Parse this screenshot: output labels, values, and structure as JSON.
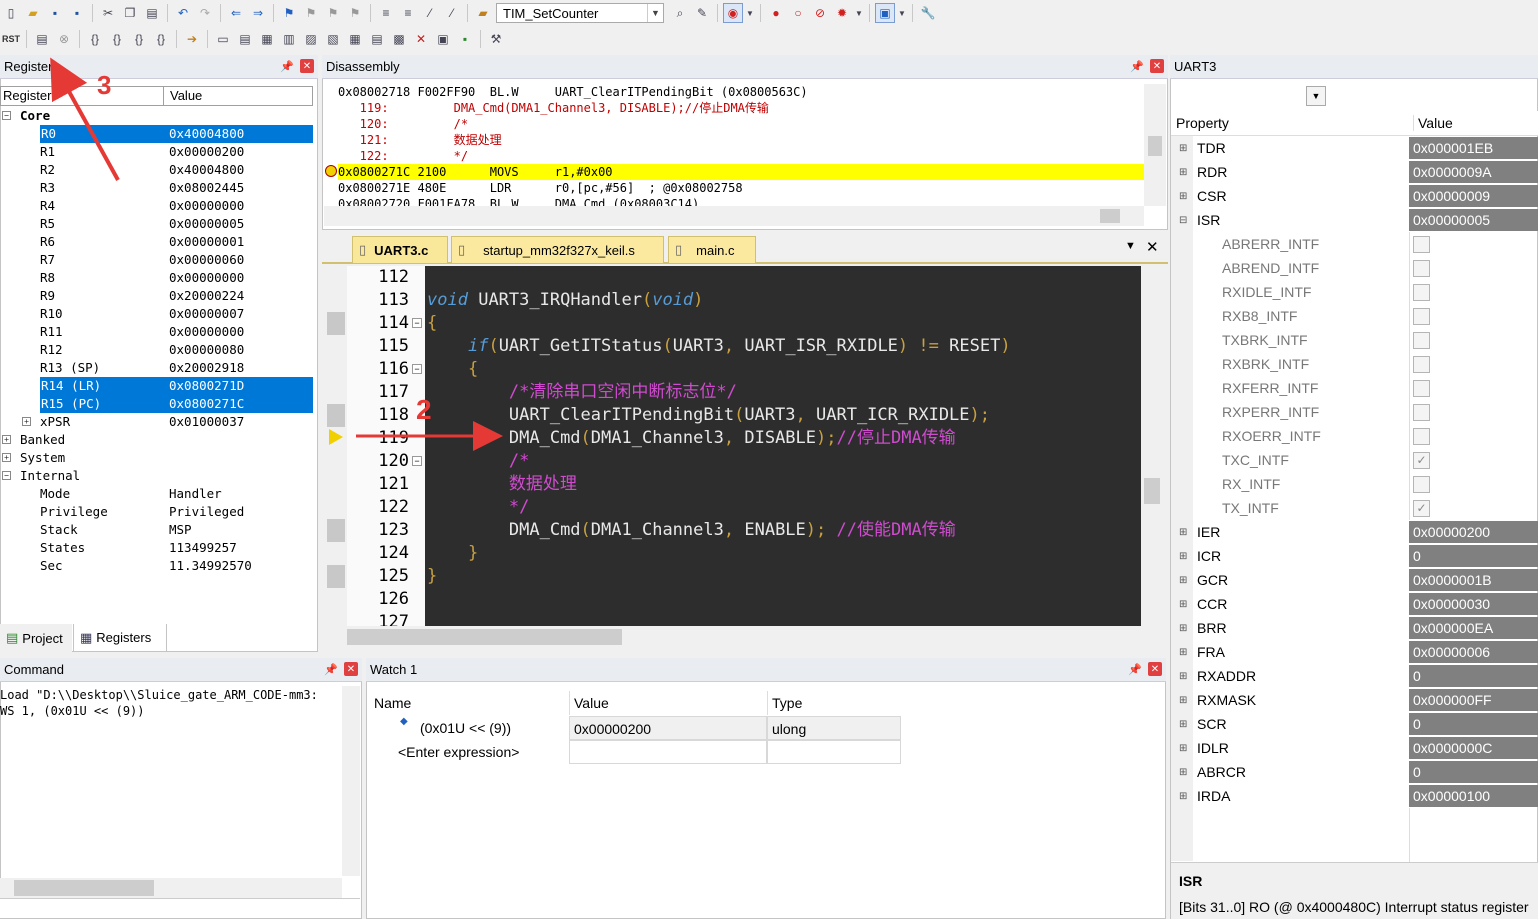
{
  "toolbar": {
    "target_combo": "TIM_SetCounter"
  },
  "registers": {
    "title": "Registers",
    "col_register": "Register",
    "col_value": "Value",
    "rows": [
      {
        "name": "Core",
        "value": ""
      },
      {
        "name": "R0",
        "value": "0x40004800"
      },
      {
        "name": "R1",
        "value": "0x00000200"
      },
      {
        "name": "R2",
        "value": "0x40004800"
      },
      {
        "name": "R3",
        "value": "0x08002445"
      },
      {
        "name": "R4",
        "value": "0x00000000"
      },
      {
        "name": "R5",
        "value": "0x00000005"
      },
      {
        "name": "R6",
        "value": "0x00000001"
      },
      {
        "name": "R7",
        "value": "0x00000060"
      },
      {
        "name": "R8",
        "value": "0x00000000"
      },
      {
        "name": "R9",
        "value": "0x20000224"
      },
      {
        "name": "R10",
        "value": "0x00000007"
      },
      {
        "name": "R11",
        "value": "0x00000000"
      },
      {
        "name": "R12",
        "value": "0x00000080"
      },
      {
        "name": "R13 (SP)",
        "value": "0x20002918"
      },
      {
        "name": "R14 (LR)",
        "value": "0x0800271D"
      },
      {
        "name": "R15 (PC)",
        "value": "0x0800271C"
      },
      {
        "name": "xPSR",
        "value": "0x01000037"
      },
      {
        "name": "Banked",
        "value": ""
      },
      {
        "name": "System",
        "value": ""
      },
      {
        "name": "Internal",
        "value": ""
      },
      {
        "name": "Mode",
        "value": "Handler"
      },
      {
        "name": "Privilege",
        "value": "Privileged"
      },
      {
        "name": "Stack",
        "value": "MSP"
      },
      {
        "name": "States",
        "value": "113499257"
      },
      {
        "name": "Sec",
        "value": "11.34992570"
      }
    ],
    "tab_project": "Project",
    "tab_registers": "Registers"
  },
  "disassembly": {
    "title": "Disassembly",
    "lines": [
      "0x08002718 F002FF90  BL.W     UART_ClearITPendingBit (0x0800563C)",
      "   119:         DMA_Cmd(DMA1_Channel3, DISABLE);//停止DMA传输",
      "   120:         /*",
      "   121:         数据处理",
      "   122:         */",
      "0x0800271C 2100      MOVS     r1,#0x00",
      "0x0800271E 480E      LDR      r0,[pc,#56]  ; @0x08002758",
      "0x08002720 F001FA78  BL.W     DMA_Cmd (0x08003C14)"
    ]
  },
  "editor": {
    "tabs": [
      "UART3.c",
      "startup_mm32f327x_keil.s",
      "main.c"
    ],
    "line_numbers": [
      "112",
      "113",
      "114",
      "115",
      "116",
      "117",
      "118",
      "119",
      "120",
      "121",
      "122",
      "123",
      "124",
      "125",
      "126",
      "127"
    ]
  },
  "annotations": {
    "arrow2": "2",
    "arrow3": "3"
  },
  "command": {
    "title": "Command",
    "line1": "Load \"D:\\\\Desktop\\\\Sluice_gate_ARM_CODE-mm3:",
    "line2": "WS 1, (0x01U << (9))"
  },
  "watch": {
    "title": "Watch 1",
    "col_name": "Name",
    "col_value": "Value",
    "col_type": "Type",
    "row_name": "(0x01U << (9))",
    "row_value": "0x00000200",
    "row_type": "ulong",
    "enter": "<Enter expression>"
  },
  "uart3": {
    "title": "UART3",
    "col_property": "Property",
    "col_value": "Value",
    "props": [
      {
        "name": "TDR",
        "value": "0x000001EB"
      },
      {
        "name": "RDR",
        "value": "0x0000009A"
      },
      {
        "name": "CSR",
        "value": "0x00000009"
      },
      {
        "name": "ISR",
        "value": "0x00000005"
      }
    ],
    "isr_bits": [
      {
        "name": "ABRERR_INTF",
        "checked": false
      },
      {
        "name": "ABREND_INTF",
        "checked": false
      },
      {
        "name": "RXIDLE_INTF",
        "checked": false
      },
      {
        "name": "RXB8_INTF",
        "checked": false
      },
      {
        "name": "TXBRK_INTF",
        "checked": false
      },
      {
        "name": "RXBRK_INTF",
        "checked": false
      },
      {
        "name": "RXFERR_INTF",
        "checked": false
      },
      {
        "name": "RXPERR_INTF",
        "checked": false
      },
      {
        "name": "RXOERR_INTF",
        "checked": false
      },
      {
        "name": "TXC_INTF",
        "checked": true
      },
      {
        "name": "RX_INTF",
        "checked": false
      },
      {
        "name": "TX_INTF",
        "checked": true
      }
    ],
    "props2": [
      {
        "name": "IER",
        "value": "0x00000200"
      },
      {
        "name": "ICR",
        "value": "0"
      },
      {
        "name": "GCR",
        "value": "0x0000001B"
      },
      {
        "name": "CCR",
        "value": "0x00000030"
      },
      {
        "name": "BRR",
        "value": "0x000000EA"
      },
      {
        "name": "FRA",
        "value": "0x00000006"
      },
      {
        "name": "RXADDR",
        "value": "0"
      },
      {
        "name": "RXMASK",
        "value": "0x000000FF"
      },
      {
        "name": "SCR",
        "value": "0"
      },
      {
        "name": "IDLR",
        "value": "0x0000000C"
      },
      {
        "name": "ABRCR",
        "value": "0"
      },
      {
        "name": "IRDA",
        "value": "0x00000100"
      }
    ],
    "desc_title": "ISR",
    "desc_text": "[Bits 31..0] RO (@ 0x4000480C) Interrupt status register"
  },
  "colors": {
    "selection": "#0078d7",
    "exec_line": "#ffff00",
    "annotation": "#e53935",
    "code_bg": "#2d2d2d"
  }
}
